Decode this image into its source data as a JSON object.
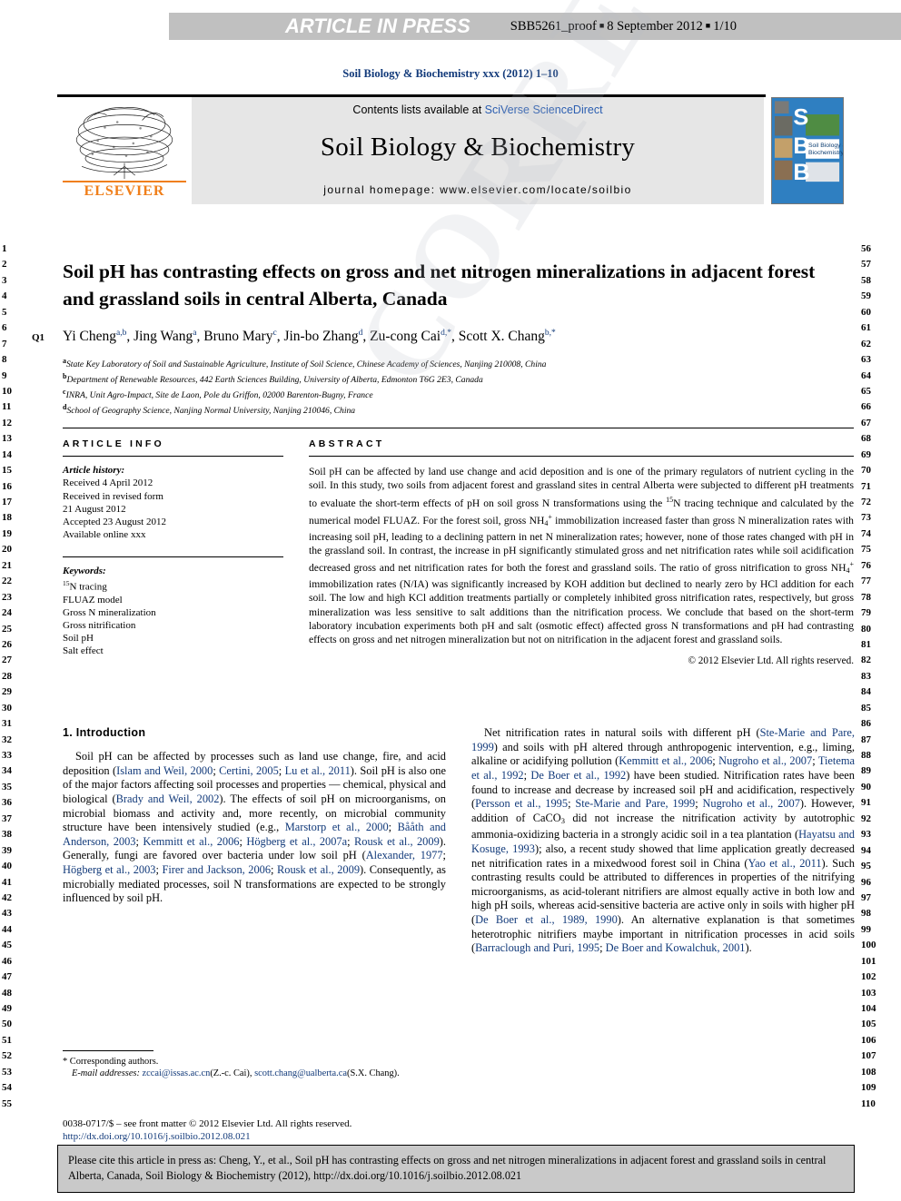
{
  "press_bar": {
    "article_in_press": "ARTICLE IN PRESS",
    "proof_id": "SBB5261_proof",
    "sep1": "■",
    "proof_date": "8 September 2012",
    "sep2": "■",
    "page_of": "1/10"
  },
  "running_head": "Soil Biology & Biochemistry xxx (2012) 1–10",
  "masthead": {
    "contents_prefix": "Contents lists available at ",
    "contents_link": "SciVerse ScienceDirect",
    "journal_title": "Soil Biology & Biochemistry",
    "homepage": "journal homepage: www.elsevier.com/locate/soilbio",
    "publisher": "ELSEVIER",
    "cover_letters": [
      "S",
      "B",
      "B"
    ],
    "cover_caption": "Soil Biology & Biochemistry"
  },
  "article": {
    "title": "Soil pH has contrasting effects on gross and net nitrogen mineralizations in adjacent forest and grassland soils in central Alberta, Canada",
    "query_flag": "Q1",
    "authors_html": "Yi Cheng<sup>a,b</sup>, Jing Wang<sup>a</sup>, Bruno Mary<sup>c</sup>, Jin-bo Zhang<sup>d</sup>, Zu-cong Cai<sup>d,*</sup>, Scott X. Chang<sup>b,*</sup>",
    "affiliations": [
      {
        "mark": "a",
        "text": "State Key Laboratory of Soil and Sustainable Agriculture, Institute of Soil Science, Chinese Academy of Sciences, Nanjing 210008, China"
      },
      {
        "mark": "b",
        "text": "Department of Renewable Resources, 442 Earth Sciences Building, University of Alberta, Edmonton T6G 2E3, Canada"
      },
      {
        "mark": "c",
        "text": "INRA, Unit Agro-Impact, Site de Laon, Pole du Griffon, 02000 Barenton-Bugny, France"
      },
      {
        "mark": "d",
        "text": "School of Geography Science, Nanjing Normal University, Nanjing 210046, China"
      }
    ]
  },
  "article_info": {
    "heading": "ARTICLE INFO",
    "history_label": "Article history:",
    "history_lines": [
      "Received 4 April 2012",
      "Received in revised form",
      "21 August 2012",
      "Accepted 23 August 2012",
      "Available online xxx"
    ],
    "keywords_label": "Keywords:",
    "keywords": [
      "15N tracing",
      "FLUAZ model",
      "Gross N mineralization",
      "Gross nitrification",
      "Soil pH",
      "Salt effect"
    ]
  },
  "abstract": {
    "heading": "ABSTRACT",
    "text_html": "Soil pH can be affected by land use change and acid deposition and is one of the primary regulators of nutrient cycling in the soil. In this study, two soils from adjacent forest and grassland sites in central Alberta were subjected to different pH treatments to evaluate the short-term effects of pH on soil gross N transformations using the <sup>15</sup>N tracing technique and calculated by the numerical model FLUAZ. For the forest soil, gross NH<sub>4</sub><sup>+</sup> immobilization increased faster than gross N mineralization rates with increasing soil pH, leading to a declining pattern in net N mineralization rates; however, none of those rates changed with pH in the grassland soil. In contrast, the increase in pH significantly stimulated gross and net nitrification rates while soil acidification decreased gross and net nitrification rates for both the forest and grassland soils. The ratio of gross nitrification to gross NH<sub>4</sub><sup>+</sup> immobilization rates (N/IA) was significantly increased by KOH addition but declined to nearly zero by HCl addition for each soil. The low and high KCl addition treatments partially or completely inhibited gross nitrification rates, respectively, but gross mineralization was less sensitive to salt additions than the nitrification process. We conclude that based on the short-term laboratory incubation experiments both pH and salt (osmotic effect) affected gross N transformations and pH had contrasting effects on gross and net nitrogen mineralization but not on nitrification in the adjacent forest and grassland soils.",
    "copyright": "© 2012 Elsevier Ltd. All rights reserved."
  },
  "introduction": {
    "heading": "1. Introduction",
    "left_paragraphs_html": [
      "Soil pH can be affected by processes such as land use change, fire, and acid deposition (<span class=\"ref\">Islam and Weil, 2000</span>; <span class=\"ref\">Certini, 2005</span>; <span class=\"ref\">Lu et al., 2011</span>). Soil pH is also one of the major factors affecting soil processes and properties &mdash; chemical, physical and biological (<span class=\"ref\">Brady and Weil, 2002</span>). The effects of soil pH on microorganisms, on microbial biomass and activity and, more recently, on microbial community structure have been intensively studied (e.g., <span class=\"ref\">Marstorp et al., 2000</span>; <span class=\"ref\">Bååth and Anderson, 2003</span>; <span class=\"ref\">Kemmitt et al., 2006</span>; <span class=\"ref\">Högberg et al., 2007a</span>; <span class=\"ref\">Rousk et al., 2009</span>). Generally, fungi are favored over bacteria under low soil pH (<span class=\"ref\">Alexander, 1977</span>; <span class=\"ref\">Högberg et al., 2003</span>; <span class=\"ref\">Firer and Jackson, 2006</span>; <span class=\"ref\">Rousk et al., 2009</span>). Consequently, as microbially mediated processes, soil N transformations are expected to be strongly influenced by soil pH."
    ],
    "right_paragraphs_html": [
      "Net nitrification rates in natural soils with different pH (<span class=\"ref\">Ste-Marie and Pare, 1999</span>) and soils with pH altered through anthropogenic intervention, e.g., liming, alkaline or acidifying pollution (<span class=\"ref\">Kemmitt et al., 2006</span>; <span class=\"ref\">Nugroho et al., 2007</span>; <span class=\"ref\">Tietema et al., 1992</span>; <span class=\"ref\">De Boer et al., 1992</span>) have been studied. Nitrification rates have been found to increase and decrease by increased soil pH and acidification, respectively (<span class=\"ref\">Persson et al., 1995</span>; <span class=\"ref\">Ste-Marie and Pare, 1999</span>; <span class=\"ref\">Nugroho et al., 2007</span>). However, addition of CaCO<sub>3</sub> did not increase the nitrification activity by autotrophic ammonia-oxidizing bacteria in a strongly acidic soil in a tea plantation (<span class=\"ref\">Hayatsu and Kosuge, 1993</span>); also, a recent study showed that lime application greatly decreased net nitrification rates in a mixedwood forest soil in China (<span class=\"ref\">Yao et al., 2011</span>). Such contrasting results could be attributed to differences in properties of the nitrifying microorganisms, as acid-tolerant nitrifiers are almost equally active in both low and high pH soils, whereas acid-sensitive bacteria are active only in soils with higher pH (<span class=\"ref\">De Boer et al., 1989, 1990</span>). An alternative explanation is that sometimes heterotrophic nitrifiers maybe important in nitrification processes in acid soils (<span class=\"ref\">Barraclough and Puri, 1995</span>; <span class=\"ref\">De Boer and Kowalchuk, 2001</span>)."
    ]
  },
  "footnote": {
    "corresponding": "* Corresponding authors.",
    "email_label": "E-mail addresses:",
    "email_1": "zccai@issas.ac.cn",
    "email_1_who": "(Z.-c. Cai),",
    "email_2": "scott.chang@ualberta.ca",
    "email_2_who": "(S.X. Chang)."
  },
  "issn": {
    "line": "0038-0717/$ – see front matter © 2012 Elsevier Ltd. All rights reserved.",
    "doi": "http://dx.doi.org/10.1016/j.soilbio.2012.08.021"
  },
  "cite_box": {
    "text": "Please cite this article in press as: Cheng, Y., et al., Soil pH has contrasting effects on gross and net nitrogen mineralizations in adjacent forest and grassland soils in central Alberta, Canada, Soil Biology & Biochemistry (2012), http://dx.doi.org/10.1016/j.soilbio.2012.08.021"
  },
  "line_numbers": {
    "left_start": 1,
    "left_end": 55,
    "right_start": 56,
    "right_end": 110
  },
  "watermark": "CORRECTED PROOF",
  "colors": {
    "link_blue": "#2a5db0",
    "ref_blue": "#123a7a",
    "press_gray": "#c0c0c0",
    "masthead_gray": "#e6e6e6",
    "cite_gray": "#c9c9c9",
    "elsevier_orange": "#f07f1a"
  }
}
